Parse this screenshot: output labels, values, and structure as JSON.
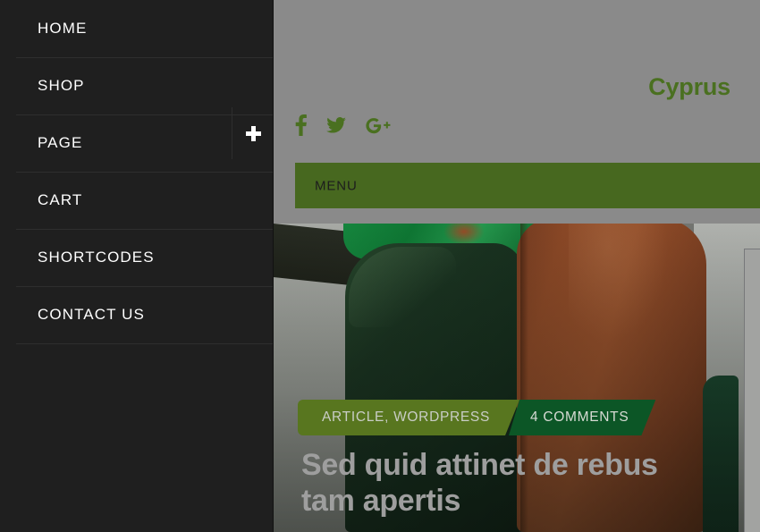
{
  "site": {
    "logo_text": "Cyprus",
    "logo_color": "#4a7020",
    "menu_bar_label": "MENU",
    "menu_bar_color": "#47681f",
    "header_overlay_color": "#8a8a8a"
  },
  "social": {
    "items": [
      {
        "name": "facebook-icon",
        "label": "f"
      },
      {
        "name": "twitter-icon",
        "label": "Twitter"
      },
      {
        "name": "google-plus-icon",
        "label": "G+"
      }
    ],
    "color": "#4a7020"
  },
  "sidebar": {
    "background": "#1f1f1f",
    "items": [
      {
        "label": "HOME",
        "has_submenu": false
      },
      {
        "label": "SHOP",
        "has_submenu": false
      },
      {
        "label": "PAGE",
        "has_submenu": true
      },
      {
        "label": "CART",
        "has_submenu": false
      },
      {
        "label": "SHORTCODES",
        "has_submenu": false
      },
      {
        "label": "CONTACT US",
        "has_submenu": false
      }
    ],
    "expand_icon": "plus-icon"
  },
  "post": {
    "category_badge": "ARTICLE, WORDPRESS",
    "category_badge_color": "#58761f",
    "comments_badge": "4 COMMENTS",
    "comments_badge_color": "#0c5626",
    "title": "Sed quid attinet de rebus tam apertis",
    "title_color": "#9e9e9e"
  },
  "hero": {
    "alt": "green and terracotta cushions on a sofa"
  },
  "right_panel": {
    "color": "#a2a3a1"
  }
}
